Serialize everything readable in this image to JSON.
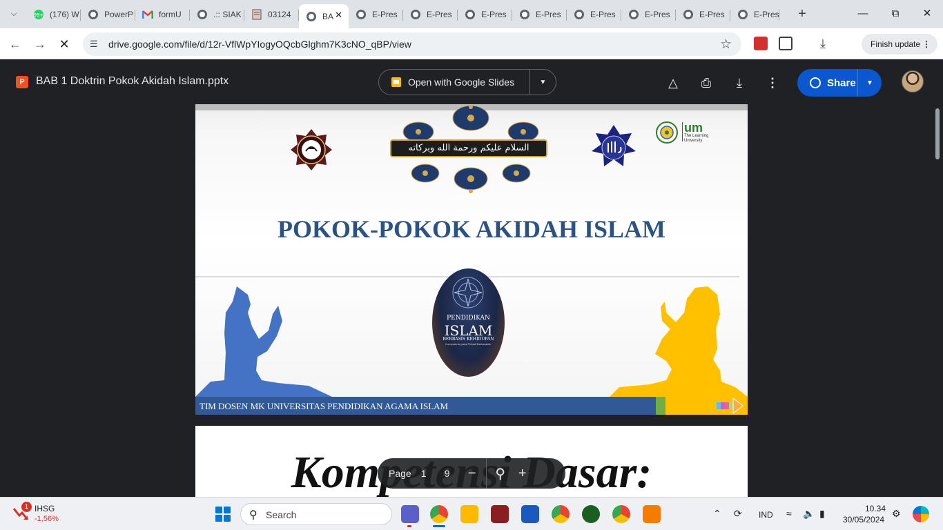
{
  "browser": {
    "tabs": [
      {
        "label": "(176) W",
        "icon": "whatsapp-icon"
      },
      {
        "label": "PowerP",
        "icon": "globe-icon"
      },
      {
        "label": "formU",
        "icon": "gmail-icon"
      },
      {
        "label": ".:: SIAK",
        "icon": "globe-icon"
      },
      {
        "label": "03124",
        "icon": "document-icon"
      },
      {
        "label": "BA",
        "icon": "globe-icon",
        "active": true
      },
      {
        "label": "E-Pres",
        "icon": "globe-icon"
      },
      {
        "label": "E-Pres",
        "icon": "globe-icon"
      },
      {
        "label": "E-Pres",
        "icon": "globe-icon"
      },
      {
        "label": "E-Pres",
        "icon": "globe-icon"
      },
      {
        "label": "E-Pres",
        "icon": "globe-icon"
      },
      {
        "label": "E-Pres",
        "icon": "globe-icon"
      },
      {
        "label": "E-Pres",
        "icon": "globe-icon"
      },
      {
        "label": "E-Pres",
        "icon": "globe-icon"
      }
    ],
    "url": "drive.google.com/file/d/12r-VflWpYIogyOQcbGlghm7K3cNO_qBP/view",
    "finish_update_label": "Finish update"
  },
  "viewer": {
    "file_name": "BAB 1 Doktrin Pokok Akidah Islam.pptx",
    "file_type_badge": "P",
    "open_with_label": "Open with Google Slides",
    "share_label": "Share"
  },
  "slide1": {
    "salam_text": "السلام عليكم ورحمة الله وبركاته",
    "um_logo_text": "um",
    "um_logo_sub": "The Learning University",
    "title": "POKOK-POKOK AKIDAH ISLAM",
    "book_line1": "PENDIDIKAN",
    "book_line2": "ISLAM",
    "book_line3": "BERBASIS KEHIDUPAN",
    "book_line4": "Kompetensi pada Pribadi Berkarakter",
    "footer_text": "TIM DOSEN MK UNIVERSITAS PENDIDIKAN AGAMA ISLAM"
  },
  "slide2": {
    "heading": "Kompetensi Dasar:"
  },
  "page_controls": {
    "label": "Page",
    "current": "1",
    "total": "9"
  },
  "taskbar": {
    "ihsg_name": "IHSG",
    "ihsg_value": "-1,56%",
    "ihsg_badge": "1",
    "search_placeholder": "Search",
    "language": "IND",
    "time": "10.34",
    "date": "30/05/2024"
  },
  "colors": {
    "drive_bg": "#202124",
    "share_blue": "#0b57d0",
    "title_blue": "#2a5384",
    "footer_blue": "#305996",
    "figure_blue": "#4472c4",
    "figure_gold": "#ffc000"
  }
}
